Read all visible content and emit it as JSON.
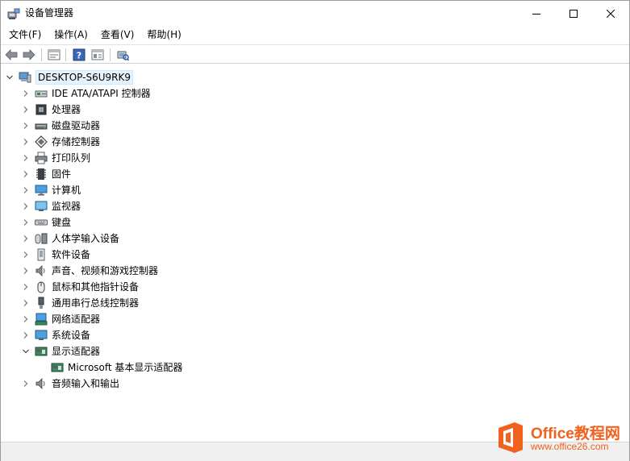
{
  "window": {
    "title": "设备管理器",
    "controls": {
      "minimize_icon": "minimize-icon",
      "maximize_icon": "maximize-icon",
      "close_icon": "close-icon"
    }
  },
  "menu": [
    "文件(F)",
    "操作(A)",
    "查看(V)",
    "帮助(H)"
  ],
  "toolbar": [
    "back-icon",
    "forward-icon",
    "properties-icon",
    "help-icon",
    "view-icon",
    "scan-hardware-icon"
  ],
  "tree": {
    "root": "DESKTOP-S6U9RK9",
    "categories": [
      {
        "label": "IDE ATA/ATAPI 控制器",
        "icon": "ide-controller-icon",
        "expanded": false
      },
      {
        "label": "处理器",
        "icon": "processor-icon",
        "expanded": false
      },
      {
        "label": "磁盘驱动器",
        "icon": "disk-drive-icon",
        "expanded": false
      },
      {
        "label": "存储控制器",
        "icon": "storage-controller-icon",
        "expanded": false
      },
      {
        "label": "打印队列",
        "icon": "print-queue-icon",
        "expanded": false
      },
      {
        "label": "固件",
        "icon": "firmware-icon",
        "expanded": false
      },
      {
        "label": "计算机",
        "icon": "computer-icon",
        "expanded": false
      },
      {
        "label": "监视器",
        "icon": "monitor-icon",
        "expanded": false
      },
      {
        "label": "键盘",
        "icon": "keyboard-icon",
        "expanded": false
      },
      {
        "label": "人体学输入设备",
        "icon": "hid-icon",
        "expanded": false
      },
      {
        "label": "软件设备",
        "icon": "software-device-icon",
        "expanded": false
      },
      {
        "label": "声音、视频和游戏控制器",
        "icon": "sound-icon",
        "expanded": false
      },
      {
        "label": "鼠标和其他指针设备",
        "icon": "mouse-icon",
        "expanded": false
      },
      {
        "label": "通用串行总线控制器",
        "icon": "usb-icon",
        "expanded": false
      },
      {
        "label": "网络适配器",
        "icon": "network-adapter-icon",
        "expanded": false
      },
      {
        "label": "系统设备",
        "icon": "system-device-icon",
        "expanded": false
      },
      {
        "label": "显示适配器",
        "icon": "display-adapter-icon",
        "expanded": true,
        "children": [
          {
            "label": "Microsoft 基本显示适配器",
            "icon": "display-adapter-icon"
          }
        ]
      },
      {
        "label": "音频输入和输出",
        "icon": "audio-io-icon",
        "expanded": false
      }
    ]
  },
  "watermark": {
    "title": "Office教程网",
    "url": "www.office26.com"
  }
}
